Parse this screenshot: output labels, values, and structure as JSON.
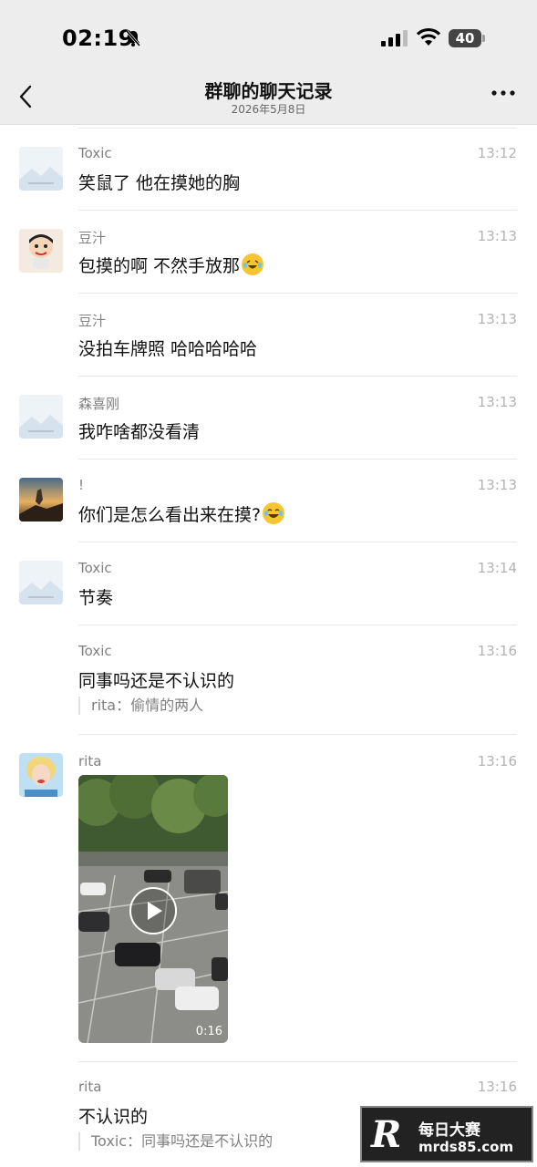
{
  "status_bar": {
    "time": "02:19",
    "battery": "40",
    "icons": [
      "bell-slash-icon",
      "signal-icon",
      "wifi-icon",
      "battery-icon"
    ]
  },
  "header": {
    "title": "群聊的聊天记录",
    "subtitle": "2026年5月8日",
    "back_icon": "chevron-left-icon",
    "more_icon": "more-icon"
  },
  "messages": [
    {
      "sender": "Toxic",
      "time": "13:12",
      "text": "笑鼠了 他在摸她的胸",
      "avatar": "placeholder"
    },
    {
      "sender": "豆汁",
      "time": "13:13",
      "text": "包摸的啊  不然手放那",
      "emoji": "laughing-crying-emoji",
      "avatar": "cartoon"
    },
    {
      "sender": "豆汁",
      "time": "13:13",
      "text": "没拍车牌照 哈哈哈哈哈",
      "avatar": "none"
    },
    {
      "sender": "森喜刚",
      "time": "13:13",
      "text": "我咋啥都没看清",
      "avatar": "placeholder"
    },
    {
      "sender": "!",
      "time": "13:13",
      "text": "你们是怎么看出来在摸?",
      "emoji": "laughing-tears-emoji",
      "avatar": "sunset"
    },
    {
      "sender": "Toxic",
      "time": "13:14",
      "text": "节奏",
      "avatar": "placeholder"
    },
    {
      "sender": "Toxic",
      "time": "13:16",
      "text": "同事吗还是不认识的",
      "quote": "rita：偷情的两人",
      "avatar": "none"
    },
    {
      "sender": "rita",
      "time": "13:16",
      "video_duration": "0:16",
      "avatar": "marilyn"
    },
    {
      "sender": "rita",
      "time": "13:16",
      "text": "不认识的",
      "quote": "Toxic：同事吗还是不认识的",
      "avatar": "none"
    }
  ],
  "watermark": {
    "logo": "R",
    "name": "每日大赛",
    "url": "mrds85.com"
  }
}
